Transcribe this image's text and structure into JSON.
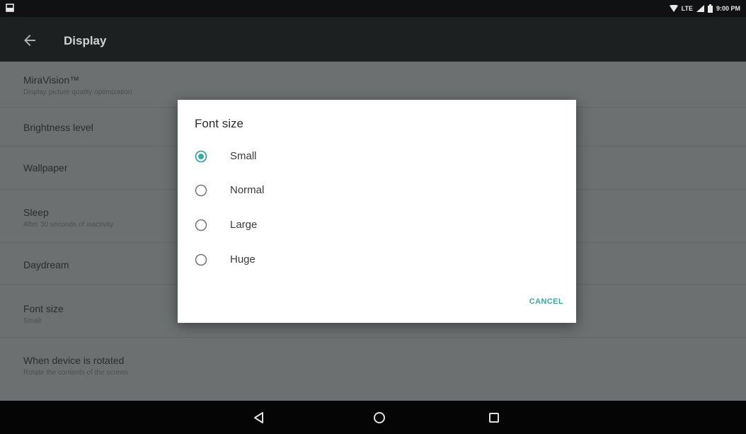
{
  "status_bar": {
    "network": "LTE",
    "time": "9:00 PM"
  },
  "app_bar": {
    "title": "Display"
  },
  "settings": [
    {
      "title": "MiraVision™",
      "subtitle": "Display picture quality optimization"
    },
    {
      "title": "Brightness level",
      "subtitle": ""
    },
    {
      "title": "Wallpaper",
      "subtitle": ""
    },
    {
      "title": "Sleep",
      "subtitle": "After 30 seconds of inactivity"
    },
    {
      "title": "Daydream",
      "subtitle": ""
    },
    {
      "title": "Font size",
      "subtitle": "Small"
    },
    {
      "title": "When device is rotated",
      "subtitle": "Rotate the contents of the screen"
    }
  ],
  "dialog": {
    "title": "Font size",
    "options": [
      {
        "label": "Small",
        "selected": true
      },
      {
        "label": "Normal",
        "selected": false
      },
      {
        "label": "Large",
        "selected": false
      },
      {
        "label": "Huge",
        "selected": false
      }
    ],
    "cancel_label": "CANCEL"
  },
  "colors": {
    "accent": "#3aa99e",
    "app_bar": "#1d2021",
    "status_bar": "#0f1112",
    "scrim_background": "#6e7273",
    "dialog_background": "#ffffff"
  },
  "icons": {
    "status_left": "notification-icon",
    "back": "back-arrow-icon",
    "nav": [
      "nav-back-icon",
      "nav-home-icon",
      "nav-recents-icon"
    ]
  }
}
